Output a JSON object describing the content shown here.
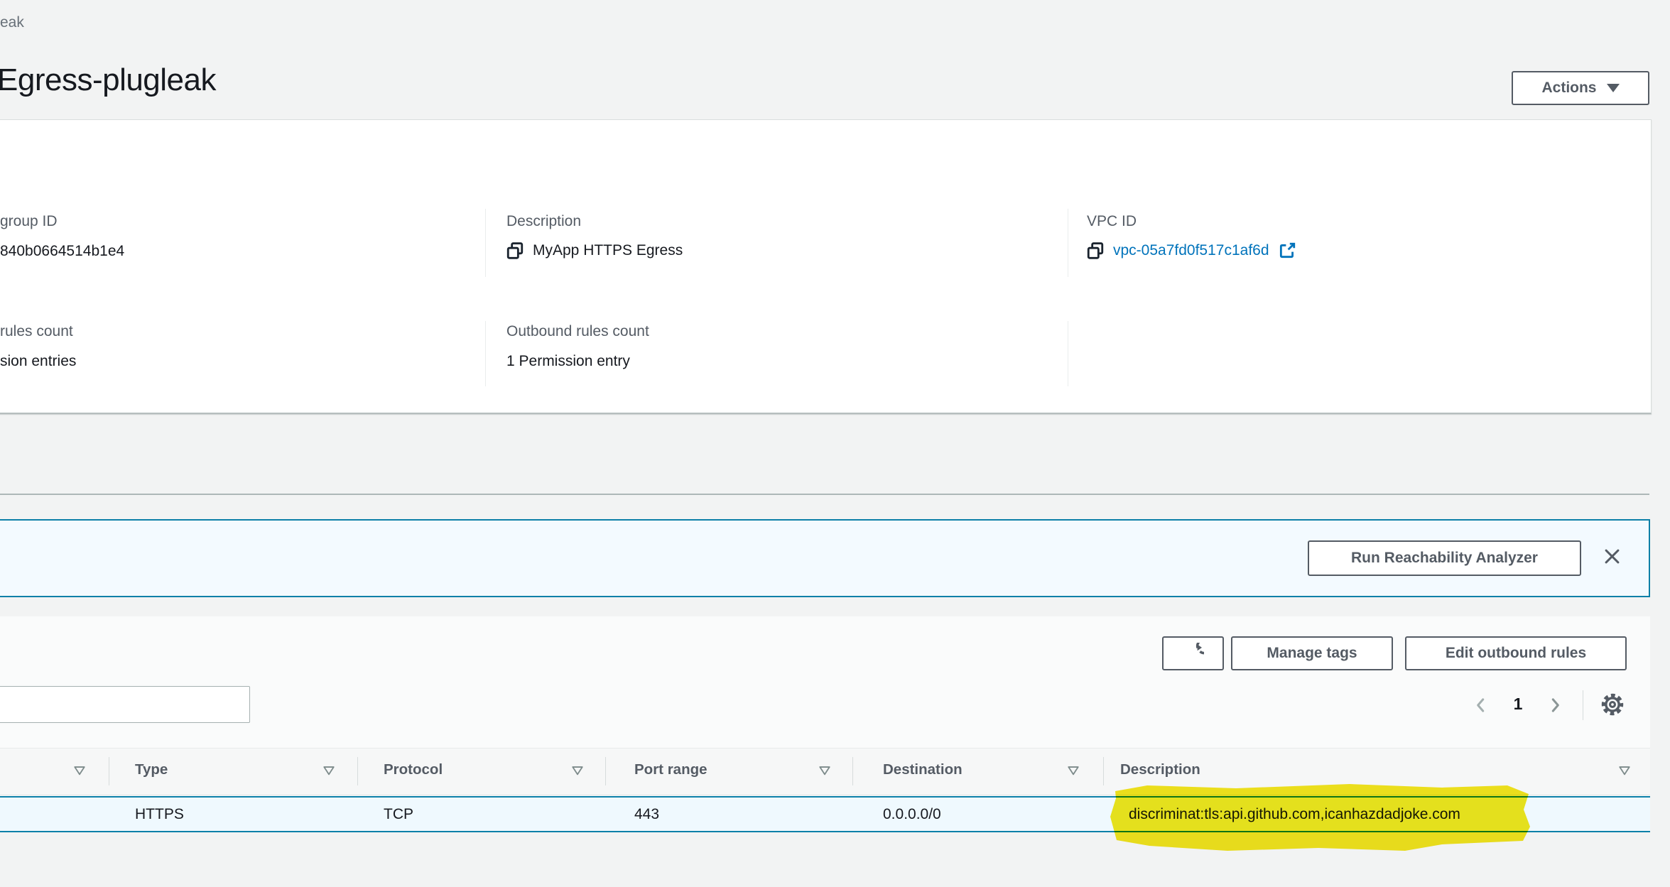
{
  "breadcrumb": {
    "trailing_text": "eak"
  },
  "header": {
    "title": "Egress-plugleak",
    "actions_label": "Actions"
  },
  "details": {
    "security_group_id": {
      "label": "group ID",
      "value": "840b0664514b1e4"
    },
    "description": {
      "label": "Description",
      "value": "MyApp HTTPS Egress"
    },
    "vpc": {
      "label": "VPC ID",
      "value": "vpc-05a7fd0f517c1af6d"
    },
    "inbound_rules": {
      "label": "rules count",
      "value": "sion entries"
    },
    "outbound_rules": {
      "label": "Outbound rules count",
      "value": "1 Permission entry"
    }
  },
  "banner": {
    "analyzer_button_label": "Run Reachability Analyzer"
  },
  "toolbar": {
    "manage_tags_label": "Manage tags",
    "edit_outbound_rules_label": "Edit outbound rules"
  },
  "pagination": {
    "current_page": "1"
  },
  "table": {
    "columns": [
      "Type",
      "Protocol",
      "Port range",
      "Destination",
      "Description"
    ],
    "row": {
      "type": "HTTPS",
      "protocol": "TCP",
      "port_range": "443",
      "destination": "0.0.0.0/0",
      "description": "discriminat:tls:api.github.com,icanhazdadjoke.com"
    }
  },
  "colors": {
    "link_blue": "#0073bb",
    "selected_row_border": "#0d80a8",
    "banner_background": "#f3faff",
    "highlight_yellow": "#f4e40b",
    "button_text": "#545b64"
  }
}
